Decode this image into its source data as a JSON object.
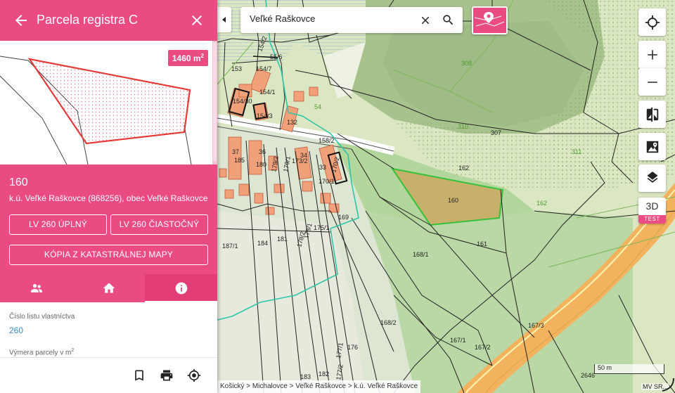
{
  "panel": {
    "header_title": "Parcela registra C",
    "area": "1460 m",
    "area_unit_sup": "2",
    "parcel_number": "160",
    "cadastral_area": "k.ú. Veľké Raškovce (868256), obec Veľké Raškovce",
    "btn_lv_full": "LV 260 ÚPLNÝ",
    "btn_lv_partial": "LV 260 ČIASTOČNÝ",
    "btn_copy_map": "KÓPIA Z KATASTRÁLNEJ MAPY",
    "tabs": [
      {
        "icon": "people-icon",
        "active": false
      },
      {
        "icon": "home-icon",
        "active": false
      },
      {
        "icon": "info-icon",
        "active": true
      }
    ],
    "ownership_sheet_label": "Číslo listu vlastníctva",
    "ownership_sheet_value": "260",
    "area_label": "Výmera parcely v m",
    "area_label_sup": "2"
  },
  "search": {
    "value": "Veľké Raškovce"
  },
  "controls": {
    "three_d": "3D",
    "test": "TEST"
  },
  "map": {
    "parcel_labels": [
      "55/6",
      "154/2",
      "153",
      "154/7",
      "154/1",
      "154/30",
      "154/3",
      "132",
      "54",
      "158/2",
      "37",
      "36",
      "185",
      "180",
      "179/2",
      "179/1",
      "173/2",
      "34",
      "33",
      "170/2",
      "170/1",
      "169",
      "175/1",
      "178/1",
      "178/2",
      "187/1",
      "184",
      "181",
      "308",
      "310",
      "307",
      "311",
      "162",
      "160",
      "162",
      "168/1",
      "161",
      "168/2",
      "167/3",
      "167/1",
      "167/2",
      "176",
      "183",
      "182",
      "177/1",
      "177/2",
      "2646"
    ]
  },
  "breadcrumb": "Košický > Michalovce > Veľké Raškovce > k.ú. Veľké Raškovce",
  "scale_label": "50 m",
  "credit": "MV SR...",
  "colors": {
    "accent": "#e94b82",
    "selected_parcel": "#35c23a",
    "road": "#f3b35e"
  }
}
